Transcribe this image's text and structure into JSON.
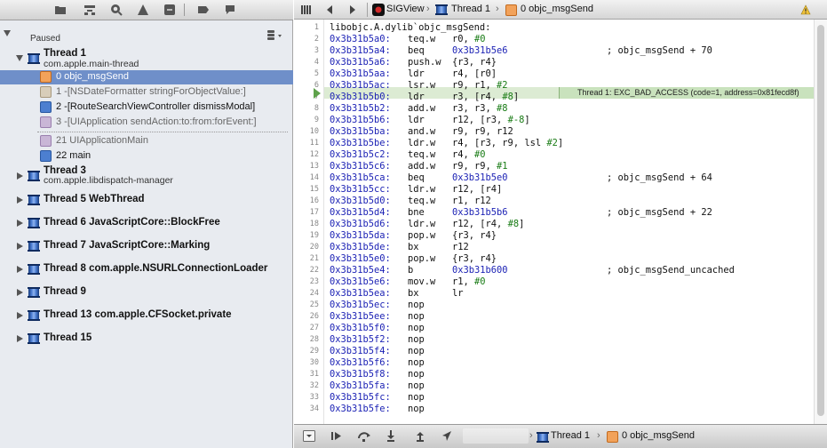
{
  "navigator": {
    "paused_label": "Paused",
    "threads": [
      {
        "title": "Thread 1",
        "subtitle": "com.apple.main-thread",
        "expanded": true
      },
      {
        "title": "Thread 3",
        "subtitle": "com.apple.libdispatch-manager",
        "expanded": false
      },
      {
        "title": "Thread 5 WebThread",
        "subtitle": "",
        "expanded": false
      },
      {
        "title": "Thread 6 JavaScriptCore::BlockFree",
        "subtitle": "",
        "expanded": false
      },
      {
        "title": "Thread 7 JavaScriptCore::Marking",
        "subtitle": "",
        "expanded": false
      },
      {
        "title": "Thread 8 com.apple.NSURLConnectionLoader",
        "subtitle": "",
        "expanded": false
      },
      {
        "title": "Thread 9",
        "subtitle": "",
        "expanded": false
      },
      {
        "title": "Thread 13 com.apple.CFSocket.private",
        "subtitle": "",
        "expanded": false
      },
      {
        "title": "Thread 15",
        "subtitle": "",
        "expanded": false
      }
    ],
    "frames": [
      {
        "label": "0 objc_msgSend",
        "selected": true
      },
      {
        "label": "1 -[NSDateFormatter stringForObjectValue:]",
        "selected": false
      },
      {
        "label": "2 -[RouteSearchViewController dismissModal]",
        "selected": false
      },
      {
        "label": "3 -[UIApplication sendAction:to:from:forEvent:]",
        "selected": false
      },
      {
        "label": "21 UIApplicationMain",
        "selected": false
      },
      {
        "label": "22 main",
        "selected": false
      }
    ]
  },
  "jumpbar": {
    "app": "SIGView",
    "thread": "Thread 1",
    "frame": "0 objc_msgSend"
  },
  "editor": {
    "header_line": "libobjc.A.dylib`objc_msgSend:",
    "lines": [
      {
        "addr": "0x3b31b5a0:",
        "op": "teq.w",
        "args": "r0, ",
        "imm": "#0",
        "comment": ""
      },
      {
        "addr": "0x3b31b5a4:",
        "op": "beq",
        "args": "",
        "target": "0x3b31b5e6",
        "comment": "; objc_msgSend + 70"
      },
      {
        "addr": "0x3b31b5a6:",
        "op": "push.w",
        "args": "{r3, r4}",
        "comment": ""
      },
      {
        "addr": "0x3b31b5aa:",
        "op": "ldr",
        "args": "r4, [r0]",
        "comment": ""
      },
      {
        "addr": "0x3b31b5ac:",
        "op": "lsr.w",
        "args": "r9, r1, ",
        "imm": "#2",
        "comment": ""
      },
      {
        "addr": "0x3b31b5b0:",
        "op": "ldr",
        "args": "r3, [r4, ",
        "imm": "#8",
        "tail": "]",
        "comment": ""
      },
      {
        "addr": "0x3b31b5b2:",
        "op": "add.w",
        "args": "r3, r3, ",
        "imm": "#8",
        "comment": ""
      },
      {
        "addr": "0x3b31b5b6:",
        "op": "ldr",
        "args": "r12, [r3, ",
        "imm": "#-8",
        "tail": "]",
        "comment": ""
      },
      {
        "addr": "0x3b31b5ba:",
        "op": "and.w",
        "args": "r9, r9, r12",
        "comment": ""
      },
      {
        "addr": "0x3b31b5be:",
        "op": "ldr.w",
        "args": "r4, [r3, r9, lsl ",
        "imm": "#2",
        "tail": "]",
        "comment": ""
      },
      {
        "addr": "0x3b31b5c2:",
        "op": "teq.w",
        "args": "r4, ",
        "imm": "#0",
        "comment": ""
      },
      {
        "addr": "0x3b31b5c6:",
        "op": "add.w",
        "args": "r9, r9, ",
        "imm": "#1",
        "comment": ""
      },
      {
        "addr": "0x3b31b5ca:",
        "op": "beq",
        "args": "",
        "target": "0x3b31b5e0",
        "comment": "; objc_msgSend + 64"
      },
      {
        "addr": "0x3b31b5cc:",
        "op": "ldr.w",
        "args": "r12, [r4]",
        "comment": ""
      },
      {
        "addr": "0x3b31b5d0:",
        "op": "teq.w",
        "args": "r1, r12",
        "comment": ""
      },
      {
        "addr": "0x3b31b5d4:",
        "op": "bne",
        "args": "",
        "target": "0x3b31b5b6",
        "comment": "; objc_msgSend + 22"
      },
      {
        "addr": "0x3b31b5d6:",
        "op": "ldr.w",
        "args": "r12, [r4, ",
        "imm": "#8",
        "tail": "]",
        "comment": ""
      },
      {
        "addr": "0x3b31b5da:",
        "op": "pop.w",
        "args": "{r3, r4}",
        "comment": ""
      },
      {
        "addr": "0x3b31b5de:",
        "op": "bx",
        "args": "r12",
        "comment": ""
      },
      {
        "addr": "0x3b31b5e0:",
        "op": "pop.w",
        "args": "{r3, r4}",
        "comment": ""
      },
      {
        "addr": "0x3b31b5e4:",
        "op": "b",
        "args": "",
        "target": "0x3b31b600",
        "comment": "; objc_msgSend_uncached"
      },
      {
        "addr": "0x3b31b5e6:",
        "op": "mov.w",
        "args": "r1, ",
        "imm": "#0",
        "comment": ""
      },
      {
        "addr": "0x3b31b5ea:",
        "op": "bx",
        "args": "lr",
        "comment": ""
      },
      {
        "addr": "0x3b31b5ec:",
        "op": "nop",
        "args": "",
        "comment": ""
      },
      {
        "addr": "0x3b31b5ee:",
        "op": "nop",
        "args": "",
        "comment": ""
      },
      {
        "addr": "0x3b31b5f0:",
        "op": "nop",
        "args": "",
        "comment": ""
      },
      {
        "addr": "0x3b31b5f2:",
        "op": "nop",
        "args": "",
        "comment": ""
      },
      {
        "addr": "0x3b31b5f4:",
        "op": "nop",
        "args": "",
        "comment": ""
      },
      {
        "addr": "0x3b31b5f6:",
        "op": "nop",
        "args": "",
        "comment": ""
      },
      {
        "addr": "0x3b31b5f8:",
        "op": "nop",
        "args": "",
        "comment": ""
      },
      {
        "addr": "0x3b31b5fa:",
        "op": "nop",
        "args": "",
        "comment": ""
      },
      {
        "addr": "0x3b31b5fc:",
        "op": "nop",
        "args": "",
        "comment": ""
      },
      {
        "addr": "0x3b31b5fe:",
        "op": "nop",
        "args": "",
        "comment": ""
      }
    ],
    "line_numbers": [
      "1",
      "2",
      "3",
      "4",
      "5",
      "6",
      "7",
      "8",
      "9",
      "10",
      "11",
      "12",
      "13",
      "14",
      "15",
      "16",
      "17",
      "18",
      "19",
      "20",
      "21",
      "22",
      "23",
      "24",
      "25",
      "26",
      "27",
      "28",
      "29",
      "30",
      "31",
      "32",
      "33",
      "34"
    ],
    "current_line": "7",
    "exception_message": "Thread 1: EXC_BAD_ACCESS (code=1, address=0x81fecd8f)"
  },
  "debugbar": {
    "thread": "Thread 1",
    "frame": "0 objc_msgSend"
  },
  "colors": {
    "selection": "#6f8fc9",
    "current_line": "#dcebd3",
    "exception_badge": "#c9e2bd",
    "address": "#1d23b5",
    "immediate": "#1a7c16"
  }
}
